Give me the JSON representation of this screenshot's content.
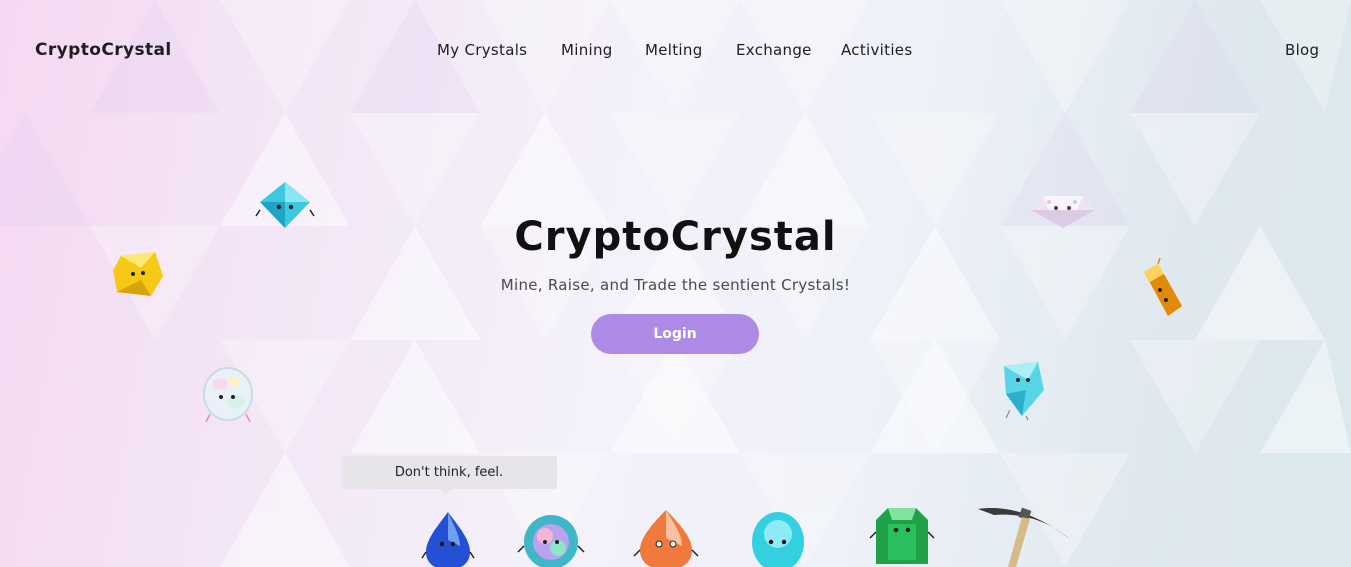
{
  "nav": {
    "brand": "CryptoCrystal",
    "items": [
      {
        "label": "My Crystals"
      },
      {
        "label": "Mining"
      },
      {
        "label": "Melting"
      },
      {
        "label": "Exchange"
      },
      {
        "label": "Activities"
      }
    ],
    "blog": "Blog"
  },
  "hero": {
    "title": "CryptoCrystal",
    "subtitle": "Mine, Raise, and Trade the sentient Crystals!",
    "login_label": "Login"
  },
  "speech_bubble": "Don't think, feel.",
  "colors": {
    "accent": "#ad8ae6",
    "bubble": "#e7e4ea"
  },
  "icons": [
    "cyan-diamond-crystal-icon",
    "gold-cube-crystal-icon",
    "opal-bubble-crystal-icon",
    "pink-diamond-crystal-icon",
    "amber-prism-crystal-icon",
    "aqua-shard-crystal-icon",
    "blue-drop-crystal-icon",
    "rainbow-round-crystal-icon",
    "orange-drop-crystal-icon",
    "aqua-oval-crystal-icon",
    "emerald-crystal-icon",
    "pickaxe-icon"
  ]
}
